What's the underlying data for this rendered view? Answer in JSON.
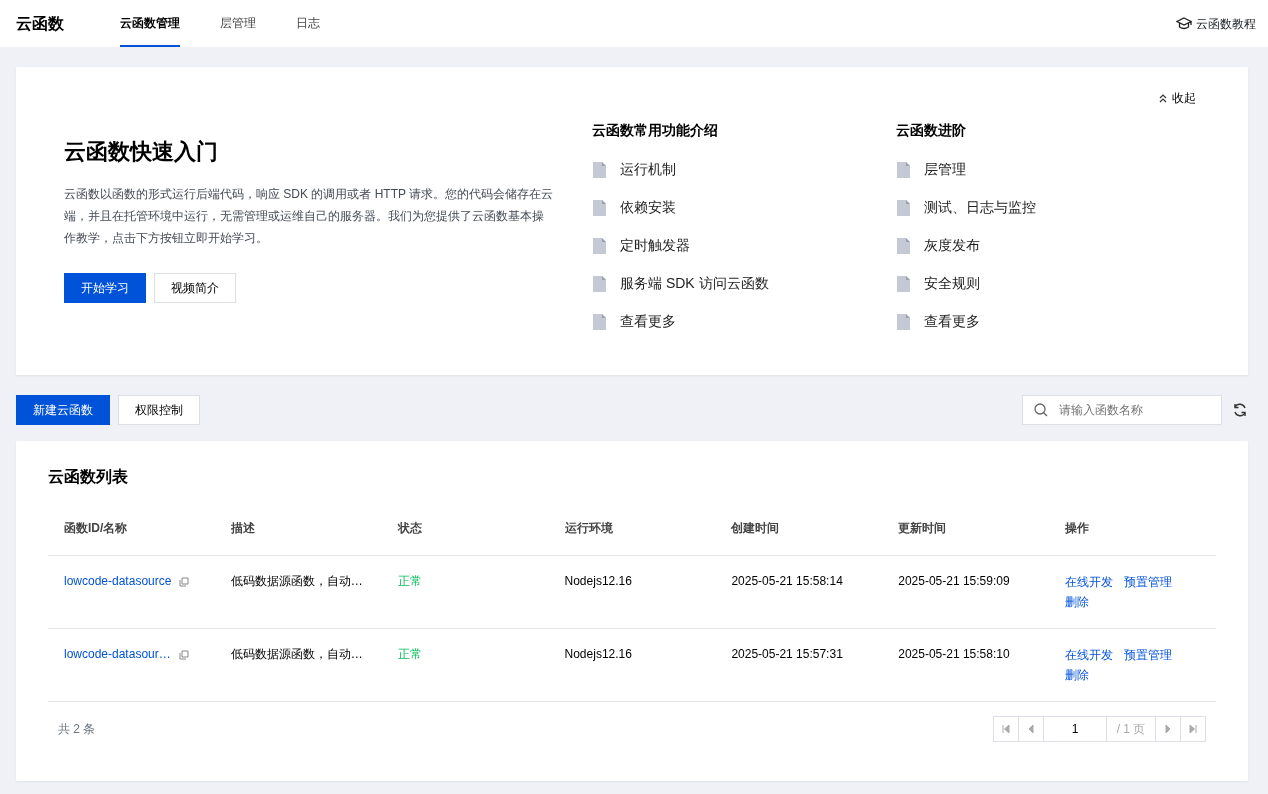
{
  "app_title": "云函数",
  "tabs": [
    {
      "label": "云函数管理",
      "selected": true
    },
    {
      "label": "层管理",
      "selected": false
    },
    {
      "label": "日志",
      "selected": false
    }
  ],
  "help_link": "云函数教程",
  "intro": {
    "title": "云函数快速入门",
    "description": "云函数以函数的形式运行后端代码，响应 SDK 的调用或者 HTTP 请求。您的代码会储存在云端，并且在托管环境中运行，无需管理或运维自己的服务器。我们为您提供了云函数基本操作教学，点击下方按钮立即开始学习。",
    "buttons": [
      {
        "label": "开始学习",
        "kind": "primary"
      },
      {
        "label": "视频简介",
        "kind": "secondary"
      }
    ],
    "collapse": "收起",
    "columns": [
      {
        "heading": "云函数常用功能介绍",
        "links": [
          "运行机制",
          "依赖安装",
          "定时触发器",
          "服务端 SDK 访问云函数",
          "查看更多"
        ]
      },
      {
        "heading": "云函数进阶",
        "links": [
          "层管理",
          "测试、日志与监控",
          "灰度发布",
          "安全规则",
          "查看更多"
        ]
      }
    ]
  },
  "toolbar": {
    "buttons": [
      {
        "label": "新建云函数",
        "kind": "primary"
      },
      {
        "label": "权限控制",
        "kind": "secondary"
      }
    ],
    "search": {
      "placeholder": "请输入函数名称"
    }
  },
  "table": {
    "title": "云函数列表",
    "columns": [
      "函数ID/名称",
      "描述",
      "状态",
      "运行环境",
      "创建时间",
      "更新时间",
      "操作"
    ],
    "rows": [
      {
        "name": "lowcode-datasource",
        "description": "低码数据源函数，自动…",
        "status": "正常",
        "runtime": "Nodejs12.16",
        "created": "2025-05-21 15:58:14",
        "updated": "2025-05-21 15:59:09",
        "actions": [
          "在线开发",
          "预置管理",
          "删除"
        ]
      },
      {
        "name": "lowcode-datasour…",
        "description": "低码数据源函数，自动…",
        "status": "正常",
        "runtime": "Nodejs12.16",
        "created": "2025-05-21 15:57:31",
        "updated": "2025-05-21 15:58:10",
        "actions": [
          "在线开发",
          "预置管理",
          "删除"
        ]
      }
    ]
  },
  "footer": {
    "total": "共 2 条",
    "page": "1",
    "page_total": "/ 1 页"
  }
}
